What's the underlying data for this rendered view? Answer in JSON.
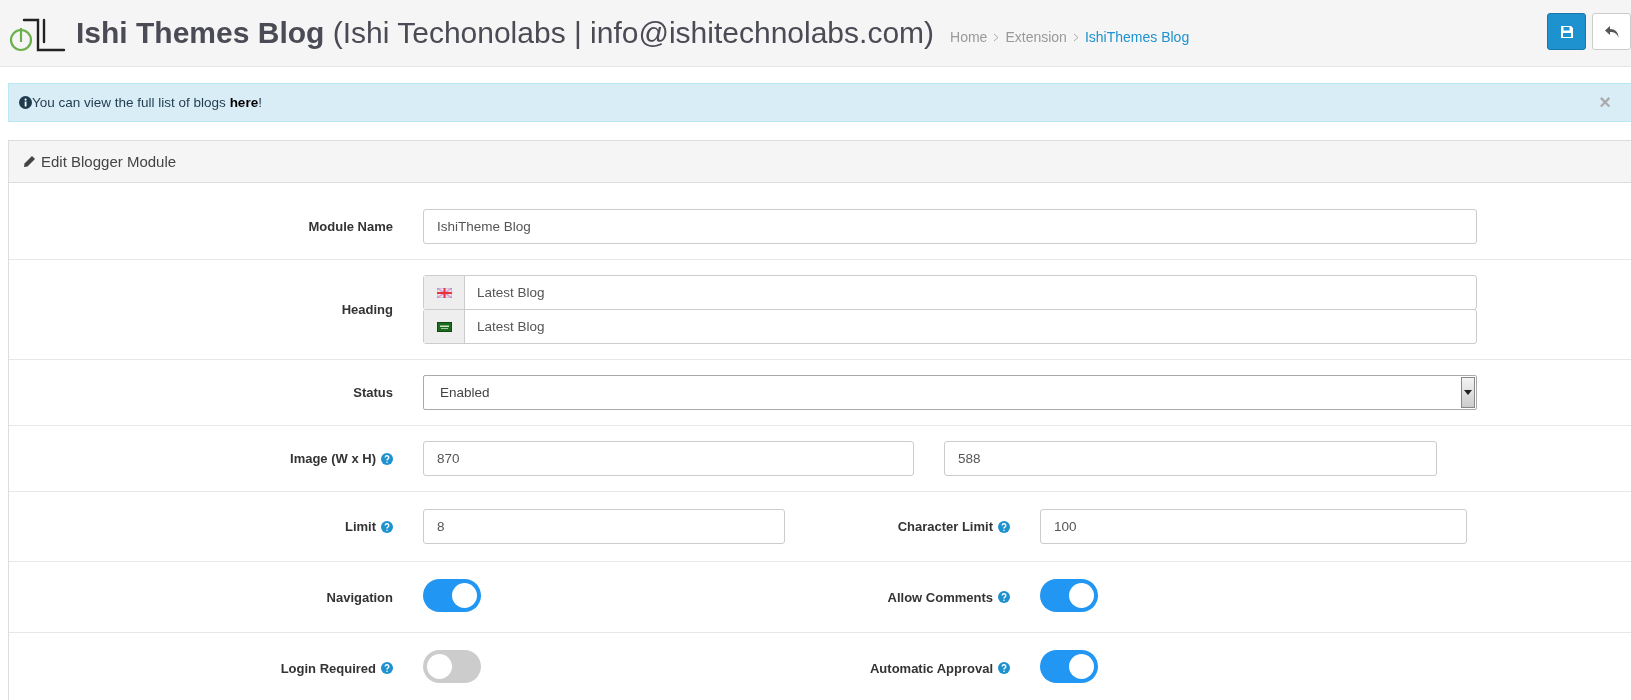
{
  "header": {
    "title": "**Ishi Themes Blog** (Ishi Techonolabs | info@ishitechnolabs.com)",
    "breadcrumbs": [
      {
        "label": "Home",
        "selected": false
      },
      {
        "label": "Extension",
        "selected": false
      },
      {
        "label": "IshiThemes Blog",
        "selected": true
      }
    ]
  },
  "alert": {
    "before": "You can view the full list of blogs ",
    "link": "here",
    "after": "!",
    "close": "×"
  },
  "panel": {
    "title": "Edit Blogger Module"
  },
  "rows": [
    {
      "kind": "text",
      "label": "Module Name",
      "help": false,
      "value": "IshiTheme Blog"
    },
    {
      "kind": "multilang",
      "label": "Heading",
      "help": false,
      "entries": [
        {
          "kind": "gb",
          "value": "Latest Blog"
        },
        {
          "kind": "sa",
          "value": "Latest Blog"
        }
      ]
    },
    {
      "kind": "select",
      "label": "Status",
      "help": false,
      "value": "Enabled"
    },
    {
      "kind": "pair",
      "label": "Image (W x H)",
      "help": true,
      "values": [
        "870",
        "588"
      ]
    },
    {
      "kind": "split",
      "fields": [
        {
          "kind": "text",
          "label": "Limit",
          "help": true,
          "value": "8"
        },
        {
          "kind": "text",
          "label": "Character Limit",
          "help": true,
          "value": "100"
        }
      ]
    },
    {
      "kind": "split",
      "fields": [
        {
          "kind": "toggle",
          "label": "Navigation",
          "help": false,
          "on": true
        },
        {
          "kind": "toggle",
          "label": "Allow Comments",
          "help": true,
          "on": true
        }
      ]
    },
    {
      "kind": "split",
      "fields": [
        {
          "kind": "toggle",
          "label": "Login Required",
          "help": true,
          "on": false
        },
        {
          "kind": "toggle",
          "label": "Automatic Approval",
          "help": true,
          "on": true
        }
      ]
    }
  ]
}
